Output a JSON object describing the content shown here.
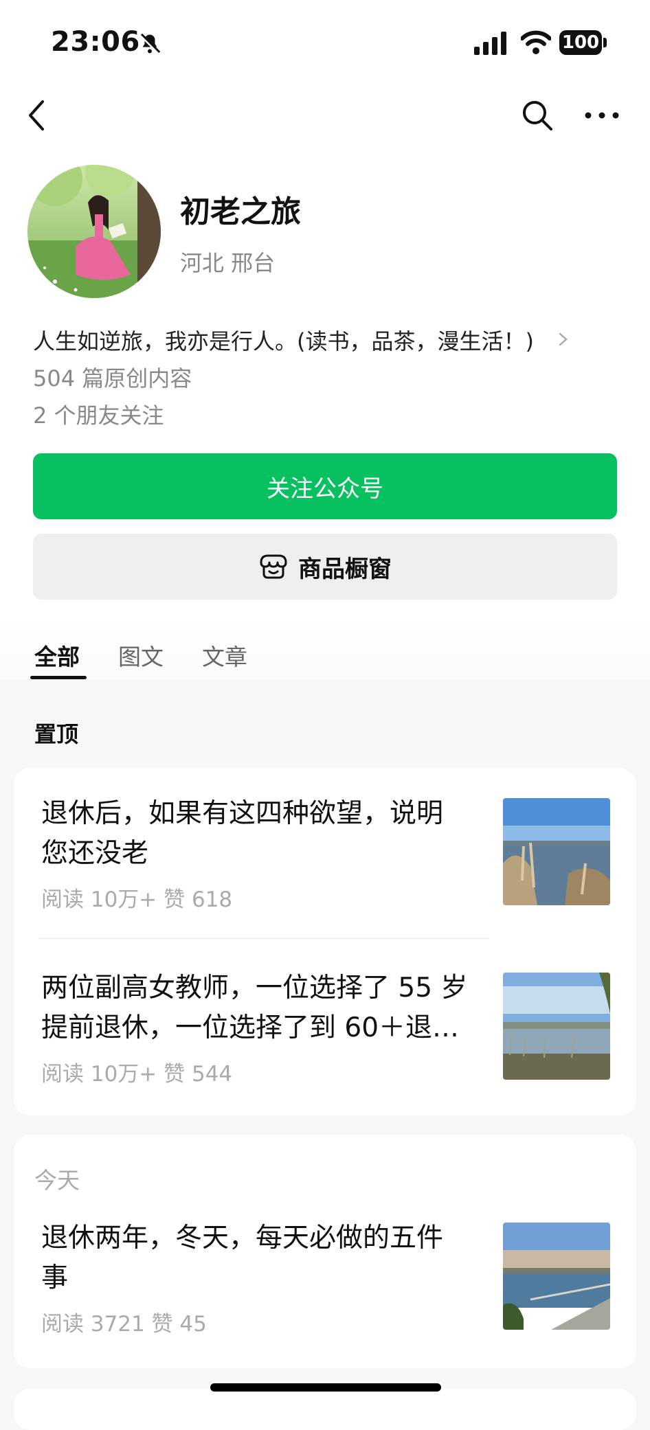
{
  "status_bar": {
    "time": "23:06",
    "battery": "100"
  },
  "profile": {
    "name": "初老之旅",
    "location": "河北 邢台",
    "bio": "人生如逆旅，我亦是行人。(读书，品茶，漫生活！)",
    "original_count": "504 篇原创内容",
    "friends_following": "2 个朋友关注"
  },
  "buttons": {
    "follow": "关注公众号",
    "shop": "商品橱窗"
  },
  "tabs": [
    {
      "label": "全部",
      "active": true
    },
    {
      "label": "图文",
      "active": false
    },
    {
      "label": "文章",
      "active": false
    }
  ],
  "pinned": {
    "label": "置顶",
    "articles": [
      {
        "title_line1": "退休后，如果有这四种欲望，说明",
        "title_line2": "您还没老",
        "meta": "阅读 10万+  赞 618"
      },
      {
        "title_line1": "两位副高女教师，一位选择了 55 岁",
        "title_line2": "提前退休，一位选择了到 60＋退…",
        "meta": "阅读 10万+  赞 544"
      }
    ]
  },
  "today": {
    "label": "今天",
    "articles": [
      {
        "title_line1": "退休两年，冬天，每天必做的五件",
        "title_line2": "事",
        "meta": "阅读 3721  赞 45"
      }
    ]
  },
  "colors": {
    "accent_green": "#07c160",
    "page_bg": "#f7f7f7",
    "meta_gray": "#aaaaaa"
  },
  "icons": [
    "bell-off-icon",
    "signal-icon",
    "wifi-icon",
    "back-icon",
    "search-icon",
    "more-icon",
    "chevron-right-icon",
    "shop-icon"
  ]
}
